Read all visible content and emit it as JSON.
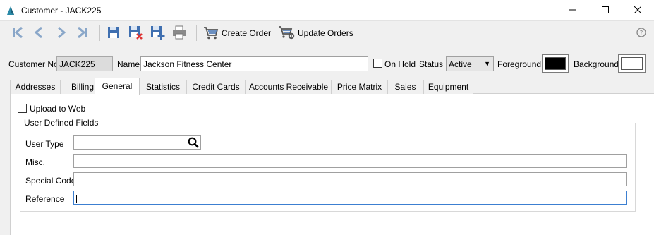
{
  "window": {
    "title": "Customer - JACK225",
    "app_icon": "spire-icon",
    "controls": [
      "minimize-icon",
      "maximize-icon",
      "close-icon"
    ]
  },
  "toolbar": {
    "nav_icons": [
      "first-record-icon",
      "previous-record-icon",
      "next-record-icon",
      "last-record-icon"
    ],
    "file_icons": [
      "save-icon",
      "save-close-icon",
      "save-new-icon",
      "print-icon"
    ],
    "create_order_label": "Create Order",
    "update_orders_label": "Update Orders",
    "help_icon": "help-icon"
  },
  "header": {
    "customer_no_label": "Customer No",
    "customer_no_value": "JACK225",
    "name_label": "Name",
    "name_value": "Jackson Fitness Center",
    "on_hold_label": "On Hold",
    "on_hold_checked": false,
    "status_label": "Status",
    "status_value": "Active",
    "foreground_label": "Foreground",
    "foreground_color": "#000000",
    "background_label": "Background",
    "background_color": "#ffffff"
  },
  "tabs": [
    {
      "label": "Addresses"
    },
    {
      "label": "Billing"
    },
    {
      "label": "General",
      "active": true
    },
    {
      "label": "Statistics"
    },
    {
      "label": "Credit Cards"
    },
    {
      "label": "Accounts Receivable"
    },
    {
      "label": "Price Matrix"
    },
    {
      "label": "Sales"
    },
    {
      "label": "Equipment"
    }
  ],
  "general": {
    "upload_to_web_label": "Upload to Web",
    "upload_to_web_checked": false,
    "udf_group_title": "User Defined Fields",
    "user_type_label": "User Type",
    "user_type_value": "",
    "misc_label": "Misc.",
    "misc_value": "",
    "special_code_label": "Special Code",
    "special_code_value": "",
    "reference_label": "Reference",
    "reference_value": ""
  },
  "colors": {
    "accent": "#4a74b5",
    "focus_border": "#3c7fd1",
    "nav_disabled": "#8aa7c9"
  }
}
